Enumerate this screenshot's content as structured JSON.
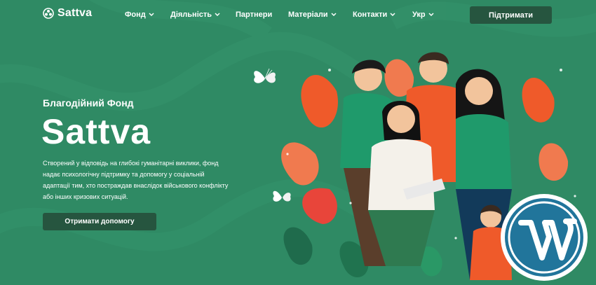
{
  "header": {
    "logo_text": "Sattva",
    "nav": [
      {
        "label": "Фонд",
        "dropdown": true
      },
      {
        "label": "Діяльність",
        "dropdown": true
      },
      {
        "label": "Партнери",
        "dropdown": false
      },
      {
        "label": "Матеріали",
        "dropdown": true
      },
      {
        "label": "Контакти",
        "dropdown": true
      },
      {
        "label": "Укр",
        "dropdown": true
      }
    ],
    "support_label": "Підтримати"
  },
  "hero": {
    "subtitle": "Благодійний Фонд",
    "title": "Sattva",
    "description_lines": [
      "Створений у відповідь на глибокі гуманітарні виклики, фонд",
      "надає психологічну підтримку та допомогу у соціальній",
      "адаптації тим, хто постраждав внаслідок військового конфлікту",
      "або інших кризових ситуацій."
    ],
    "cta_label": "Отримати допомогу"
  },
  "colors": {
    "background": "#2f8a64",
    "button": "#26553f",
    "accent_orange": "#ef5a2a",
    "wordpress_blue": "#21759b"
  },
  "icons": [
    "sattva-logo-icon",
    "chevron-down-icon",
    "butterfly-icon",
    "wordpress-logo-icon"
  ]
}
